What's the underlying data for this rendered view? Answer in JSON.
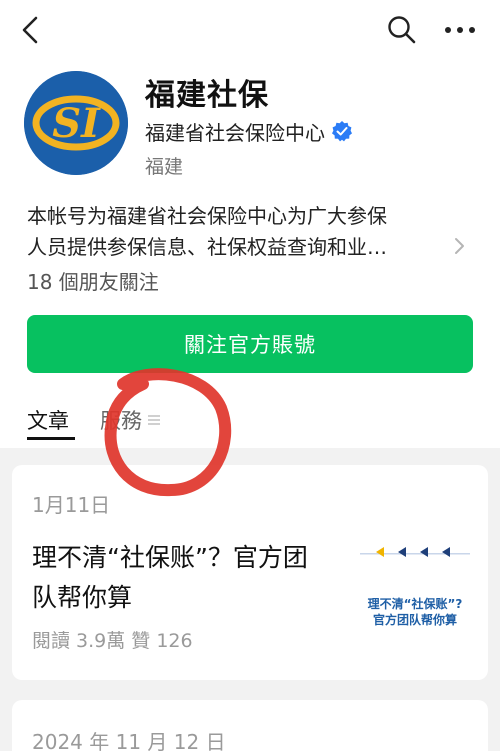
{
  "header": {
    "back_icon": "chevron-left-icon",
    "search_icon": "search-icon",
    "more_icon": "more-dots-icon"
  },
  "account": {
    "name": "福建社保",
    "organization": "福建省社会保险中心",
    "region": "福建",
    "avatar_text": "SI",
    "description_line1": "本帐号为福建省社会保险中心为广大参保",
    "description_line2": "人员提供参保信息、社保权益查询和业…",
    "followers": "18 個朋友關注",
    "follow_button": "關注官方賬號"
  },
  "tabs": [
    {
      "label": "文章",
      "active": true
    },
    {
      "label": "服務",
      "active": false
    }
  ],
  "articles": [
    {
      "date": "1月11日",
      "title_line1": "理不清“社保账”？官方团",
      "title_line2": "队帮你算",
      "meta": "閱讀 3.9萬  贊 126",
      "thumb_line1": "理不清“社保账”?",
      "thumb_line2": "官方团队帮你算"
    },
    {
      "date": "2024 年 11 月 12 日"
    }
  ],
  "colors": {
    "accent_green": "#07c160",
    "verified_blue": "#2b7cf6",
    "avatar_blue": "#1b5faa",
    "avatar_gold": "#f2b322",
    "annotation_red": "#e0352b",
    "thumb_arrow_yellow": "#f0b400",
    "thumb_arrow_navy": "#1f3f7a"
  }
}
